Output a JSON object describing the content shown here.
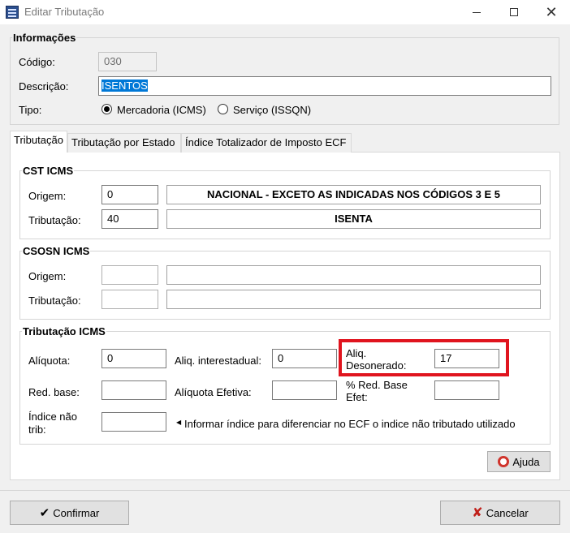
{
  "window": {
    "title": "Editar Tributação"
  },
  "informacoes": {
    "group_title": "Informações",
    "codigo_label": "Código:",
    "codigo_value": "030",
    "descricao_label": "Descrição:",
    "descricao_value": "ISENTOS",
    "tipo_label": "Tipo:",
    "tipo_options": [
      {
        "label": "Mercadoria (ICMS)",
        "checked": true
      },
      {
        "label": "Serviço (ISSQN)",
        "checked": false
      }
    ]
  },
  "tabs": [
    {
      "label": "Tributação",
      "active": true
    },
    {
      "label": "Tributação por Estado",
      "active": false
    },
    {
      "label": "Índice Totalizador de Imposto ECF",
      "active": false
    }
  ],
  "cst_icms": {
    "group_title": "CST ICMS",
    "origem_label": "Origem:",
    "origem_code": "0",
    "origem_desc": "NACIONAL - EXCETO AS INDICADAS NOS CÓDIGOS 3 E 5",
    "tributacao_label": "Tributação:",
    "tributacao_code": "40",
    "tributacao_desc": "ISENTA"
  },
  "csosn_icms": {
    "group_title": "CSOSN ICMS",
    "origem_label": "Origem:",
    "origem_code": "",
    "origem_desc": "",
    "tributacao_label": "Tributação:",
    "tributacao_code": "",
    "tributacao_desc": ""
  },
  "tributacao_icms": {
    "group_title": "Tributação ICMS",
    "aliquota_label": "Alíquota:",
    "aliquota_value": "0",
    "aliq_interestadual_label": "Aliq. interestadual:",
    "aliq_interestadual_value": "0",
    "aliq_desonerado_label": "Aliq. Desonerado:",
    "aliq_desonerado_value": "17",
    "red_base_label": "Red. base:",
    "red_base_value": "",
    "aliquota_efetiva_label": "Alíquota Efetiva:",
    "aliquota_efetiva_value": "",
    "red_base_efet_label": "% Red. Base Efet:",
    "red_base_efet_value": "",
    "indice_nao_trib_label": "Índice não trib:",
    "indice_nao_trib_value": "",
    "info_text": "Informar índice para diferenciar no ECF o indice não tributado utilizado"
  },
  "buttons": {
    "ajuda": "Ajuda",
    "confirmar": "Confirmar",
    "cancelar": "Cancelar"
  },
  "colors": {
    "highlight": "#e0141e",
    "selection": "#0078d7"
  }
}
